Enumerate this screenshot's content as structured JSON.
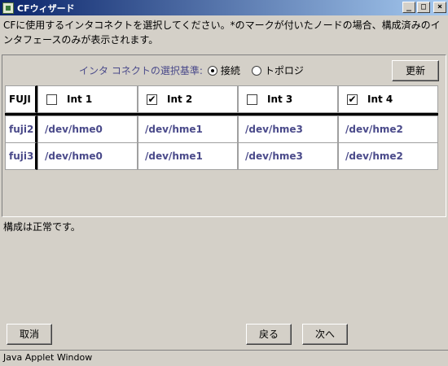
{
  "window": {
    "title": "CFウィザード",
    "controls": {
      "minimize": "_",
      "maximize": "□",
      "close": "×"
    }
  },
  "instructions": "CFに使用するインタコネクトを選択してください。*のマークが付いたノードの場合、構成済みのインタフェースのみが表示されます。",
  "criteria": {
    "label": "インタ コネクトの選択基準:",
    "options": [
      {
        "label": "接続",
        "selected": true
      },
      {
        "label": "トポロジ",
        "selected": false
      }
    ]
  },
  "refresh_label": "更新",
  "table": {
    "corner": "FUJI",
    "columns": [
      {
        "label": "Int 1",
        "checked": false,
        "mark": ""
      },
      {
        "label": "Int 2",
        "checked": true,
        "mark": "✔"
      },
      {
        "label": "Int 3",
        "checked": false,
        "mark": ""
      },
      {
        "label": "Int 4",
        "checked": true,
        "mark": "✔"
      }
    ],
    "rows": [
      {
        "node": "fuji2",
        "cells": [
          "/dev/hme0",
          "/dev/hme1",
          "/dev/hme3",
          "/dev/hme2"
        ]
      },
      {
        "node": "fuji3",
        "cells": [
          "/dev/hme0",
          "/dev/hme1",
          "/dev/hme3",
          "/dev/hme2"
        ]
      }
    ]
  },
  "status_text": "構成は正常です。",
  "buttons": {
    "cancel": "取消",
    "back": "戻る",
    "next": "次へ"
  },
  "footer": "Java Applet Window"
}
